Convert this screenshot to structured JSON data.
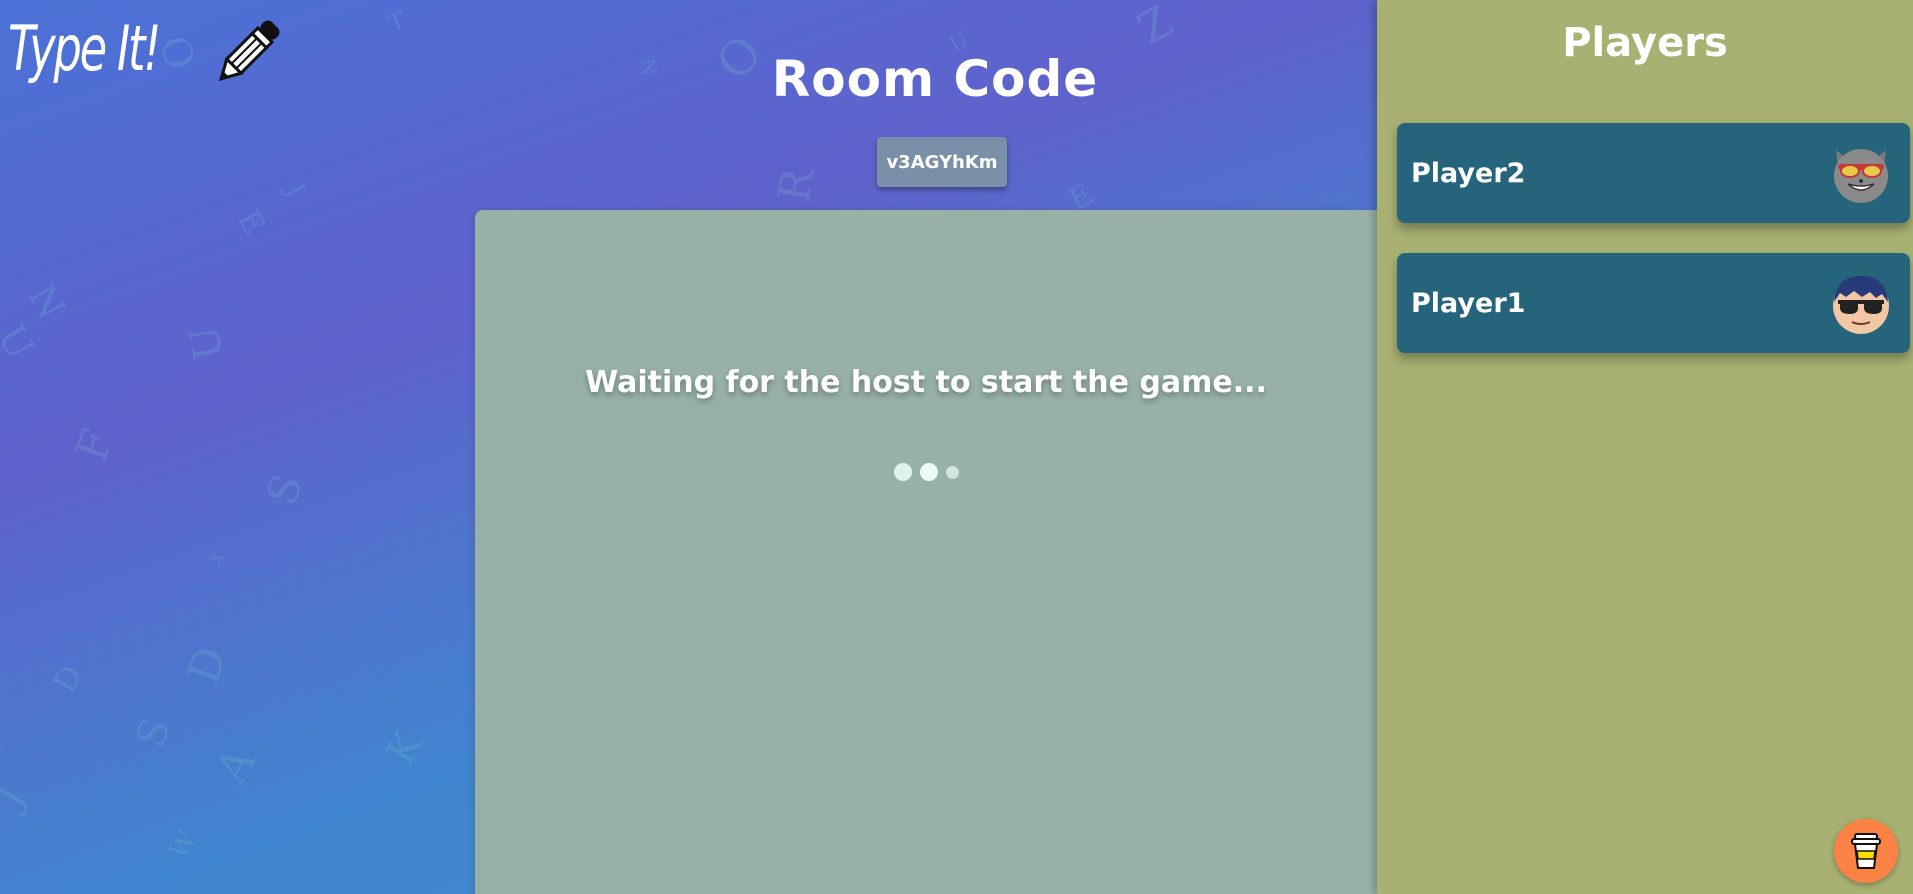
{
  "app": {
    "logo_text": "Type It!",
    "logo_icon": "pencil-icon"
  },
  "room": {
    "title": "Room Code",
    "code": "v3AGYhKm"
  },
  "waiting": {
    "message": "Waiting for the host to start the game..."
  },
  "players": {
    "title": "Players",
    "list": [
      {
        "name": "Player2",
        "avatar": "cat-sunglasses-avatar"
      },
      {
        "name": "Player1",
        "avatar": "boy-sunglasses-avatar"
      }
    ]
  },
  "support": {
    "icon": "coffee-cup-icon"
  },
  "colors": {
    "players_panel": "#a8b072",
    "player_card": "#25647a",
    "wait_panel": "#97b1a7",
    "room_code_bg": "#7a8fa8",
    "coffee_button": "#fa8244"
  }
}
